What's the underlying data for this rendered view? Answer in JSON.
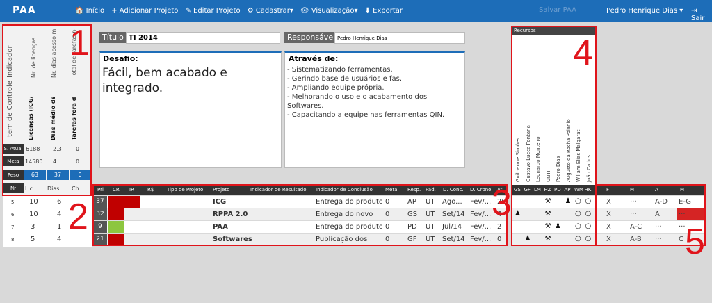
{
  "app": {
    "brand": "PAA"
  },
  "nav": {
    "items": [
      "🏠 Início",
      "+ Adicionar Projeto",
      "✎ Editar Projeto",
      "⚙ Cadastrar▾",
      "👁 Visualização▾",
      "⬇ Exportar"
    ],
    "save_label": "Salvar PAA",
    "user": "Pedro Henrique Dias ▾",
    "logout": "⇥ Sair"
  },
  "indicators": {
    "header_indicador": "Indicador",
    "header_item": "Item de Controle",
    "columns": [
      {
        "indicador": "Nr. de licenças",
        "item": "Licenças (ICG/RPP...",
        "atual": "6188",
        "meta": "14580",
        "peso": "63",
        "foot": "Lic."
      },
      {
        "indicador": "Nr. dias acesso médio...",
        "item": "Dias médio de ini...",
        "atual": "2,3",
        "meta": "4",
        "peso": "37",
        "foot": "Dias"
      },
      {
        "indicador": "Total de tarefas não ...",
        "item": "Tarefas fora do S...",
        "atual": "0",
        "meta": "0",
        "peso": "0",
        "foot": "Ch."
      }
    ],
    "row_labels": {
      "atual": "S. Atual",
      "meta": "Meta",
      "peso": "Peso",
      "nr": "Nr"
    },
    "left_rows": [
      {
        "nr": "5",
        "a": "10",
        "b": "6"
      },
      {
        "nr": "6",
        "a": "10",
        "b": "4"
      },
      {
        "nr": "7",
        "a": "3",
        "b": "1"
      },
      {
        "nr": "8",
        "a": "5",
        "b": "4"
      }
    ]
  },
  "form": {
    "title_label": "Título",
    "title_value": "TI 2014",
    "resp_label": "Responsável",
    "resp_value": "Pedro Henrique Dias",
    "desafio_label": "Desafio:",
    "desafio_text": "Fácil, bem acabado e integrado.",
    "atraves_label": "Através de:",
    "atraves_lines": [
      "- Sistematizando ferramentas.",
      "- Gerindo base de usuários e fas.",
      "- Ampliando equipe própria.",
      "- Melhorando o uso e o acabamento dos Softwares.",
      "- Capacitando a equipe nas ferramentas QIN."
    ]
  },
  "resources": {
    "title": "Recursos",
    "people": [
      "Guilherme Simões",
      "Gustavo Lucca Fontana",
      "Leonardo Monteiro",
      "UNTI",
      "Pedro Dias",
      "Augusto da Rocha Polanio",
      "Wiliam Elias Malgarat",
      "João Carlos"
    ],
    "codes": [
      "GS",
      "GF",
      "LM",
      "HZ",
      "PD",
      "AP",
      "WM",
      "HK"
    ]
  },
  "table": {
    "headers": [
      "Pri",
      "CR",
      "IR",
      "R$",
      "Tipo de Projeto",
      "Projeto",
      "Indicador de Resultado",
      "Indicador de Conclusão",
      "Meta",
      "Resp.",
      "Pad.",
      "D. Conc.",
      "D. Crono.",
      "Ati"
    ],
    "rows": [
      {
        "pri": "37",
        "cr": "#c00000",
        "ir": "#c00000",
        "projeto": "ICG",
        "conclusao": "Entrega do produto",
        "meta": "0",
        "resp": "AP",
        "pad": "UT",
        "dconc": "Ago...",
        "dcrono": "Fev/...",
        "ati": "20",
        "shade": "#ffffff",
        "icons": [
          "",
          "",
          "",
          "hammer",
          "",
          "person",
          "circle",
          "circle"
        ],
        "right": [
          "X",
          "···",
          "A-D",
          "E-G"
        ]
      },
      {
        "pri": "32",
        "cr": "#c00000",
        "ir": "",
        "projeto": "RPPA 2.0",
        "conclusao": "Entrega do novo",
        "meta": "0",
        "resp": "GS",
        "pad": "UT",
        "dconc": "Set/14",
        "dcrono": "Fev/...",
        "ati": "4",
        "shade": "#eeeeee",
        "icons": [
          "person",
          "",
          "",
          "hammer",
          "",
          "",
          "circle",
          "circle"
        ],
        "right": [
          "X",
          "···",
          "A",
          "···"
        ]
      },
      {
        "pri": "9",
        "cr": "#8dc63f",
        "ir": "",
        "projeto": "PAA",
        "conclusao": "Entrega do produto",
        "meta": "0",
        "resp": "PD",
        "pad": "UT",
        "dconc": "Jul/14",
        "dcrono": "Fev/...",
        "ati": "2",
        "shade": "#ffffff",
        "icons": [
          "",
          "",
          "",
          "hammer",
          "person",
          "",
          "circle",
          "circle"
        ],
        "right": [
          "X",
          "A-C",
          "···",
          "···"
        ]
      },
      {
        "pri": "21",
        "cr": "#c00000",
        "ir": "",
        "projeto": "Softwares",
        "conclusao": "Publicação dos",
        "meta": "0",
        "resp": "GF",
        "pad": "UT",
        "dconc": "Set/14",
        "dcrono": "Fev/...",
        "ati": "0",
        "shade": "#eeeeee",
        "icons": [
          "",
          "person",
          "",
          "hammer",
          "",
          "",
          "circle",
          "circle"
        ],
        "right": [
          "X",
          "A-B",
          "···",
          "C"
        ]
      }
    ]
  },
  "right_table": {
    "headers": [
      "F",
      "M",
      "A",
      "M"
    ]
  },
  "annotations": [
    "1",
    "2",
    "3",
    "4",
    "5"
  ]
}
